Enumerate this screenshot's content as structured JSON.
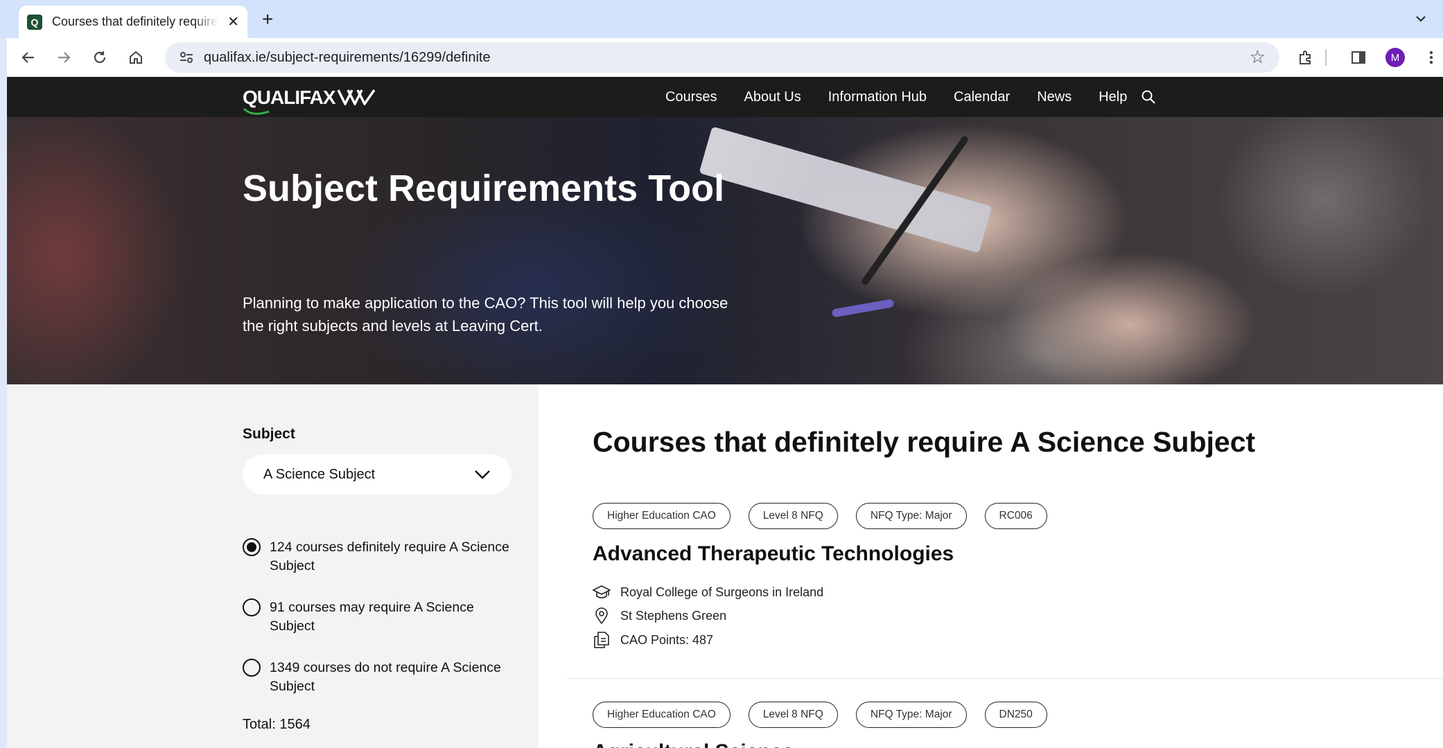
{
  "browser": {
    "tab_title": "Courses that definitely require A Science Subject",
    "favicon_letter": "Q",
    "url": "qualifax.ie/subject-requirements/16299/definite",
    "profile_initial": "M"
  },
  "site": {
    "logo_text": "QUALIFAX",
    "nav": [
      "Courses",
      "About Us",
      "Information Hub",
      "Calendar",
      "News",
      "Help"
    ]
  },
  "hero": {
    "title": "Subject Requirements Tool",
    "subtitle": "Planning to make application to the CAO? This tool will help you choose the right subjects and levels at Leaving Cert."
  },
  "filter": {
    "label": "Subject",
    "selected": "A Science Subject",
    "options": [
      {
        "text": "124 courses definitely require A Science Subject",
        "selected": true
      },
      {
        "text": "91 courses may require A Science Subject",
        "selected": false
      },
      {
        "text": "1349 courses do not require A Science Subject",
        "selected": false
      }
    ],
    "total": "Total: 1564"
  },
  "results": {
    "heading": "Courses that definitely require A Science Subject",
    "courses": [
      {
        "badges": [
          "Higher Education CAO",
          "Level 8 NFQ",
          "NFQ Type: Major",
          "RC006"
        ],
        "title": "Advanced Therapeutic Technologies",
        "college": "Royal College of Surgeons in Ireland",
        "location": "St Stephens Green",
        "points": "CAO Points: 487"
      },
      {
        "badges": [
          "Higher Education CAO",
          "Level 8 NFQ",
          "NFQ Type: Major",
          "DN250"
        ],
        "title": "Agricultural Science"
      }
    ]
  }
}
